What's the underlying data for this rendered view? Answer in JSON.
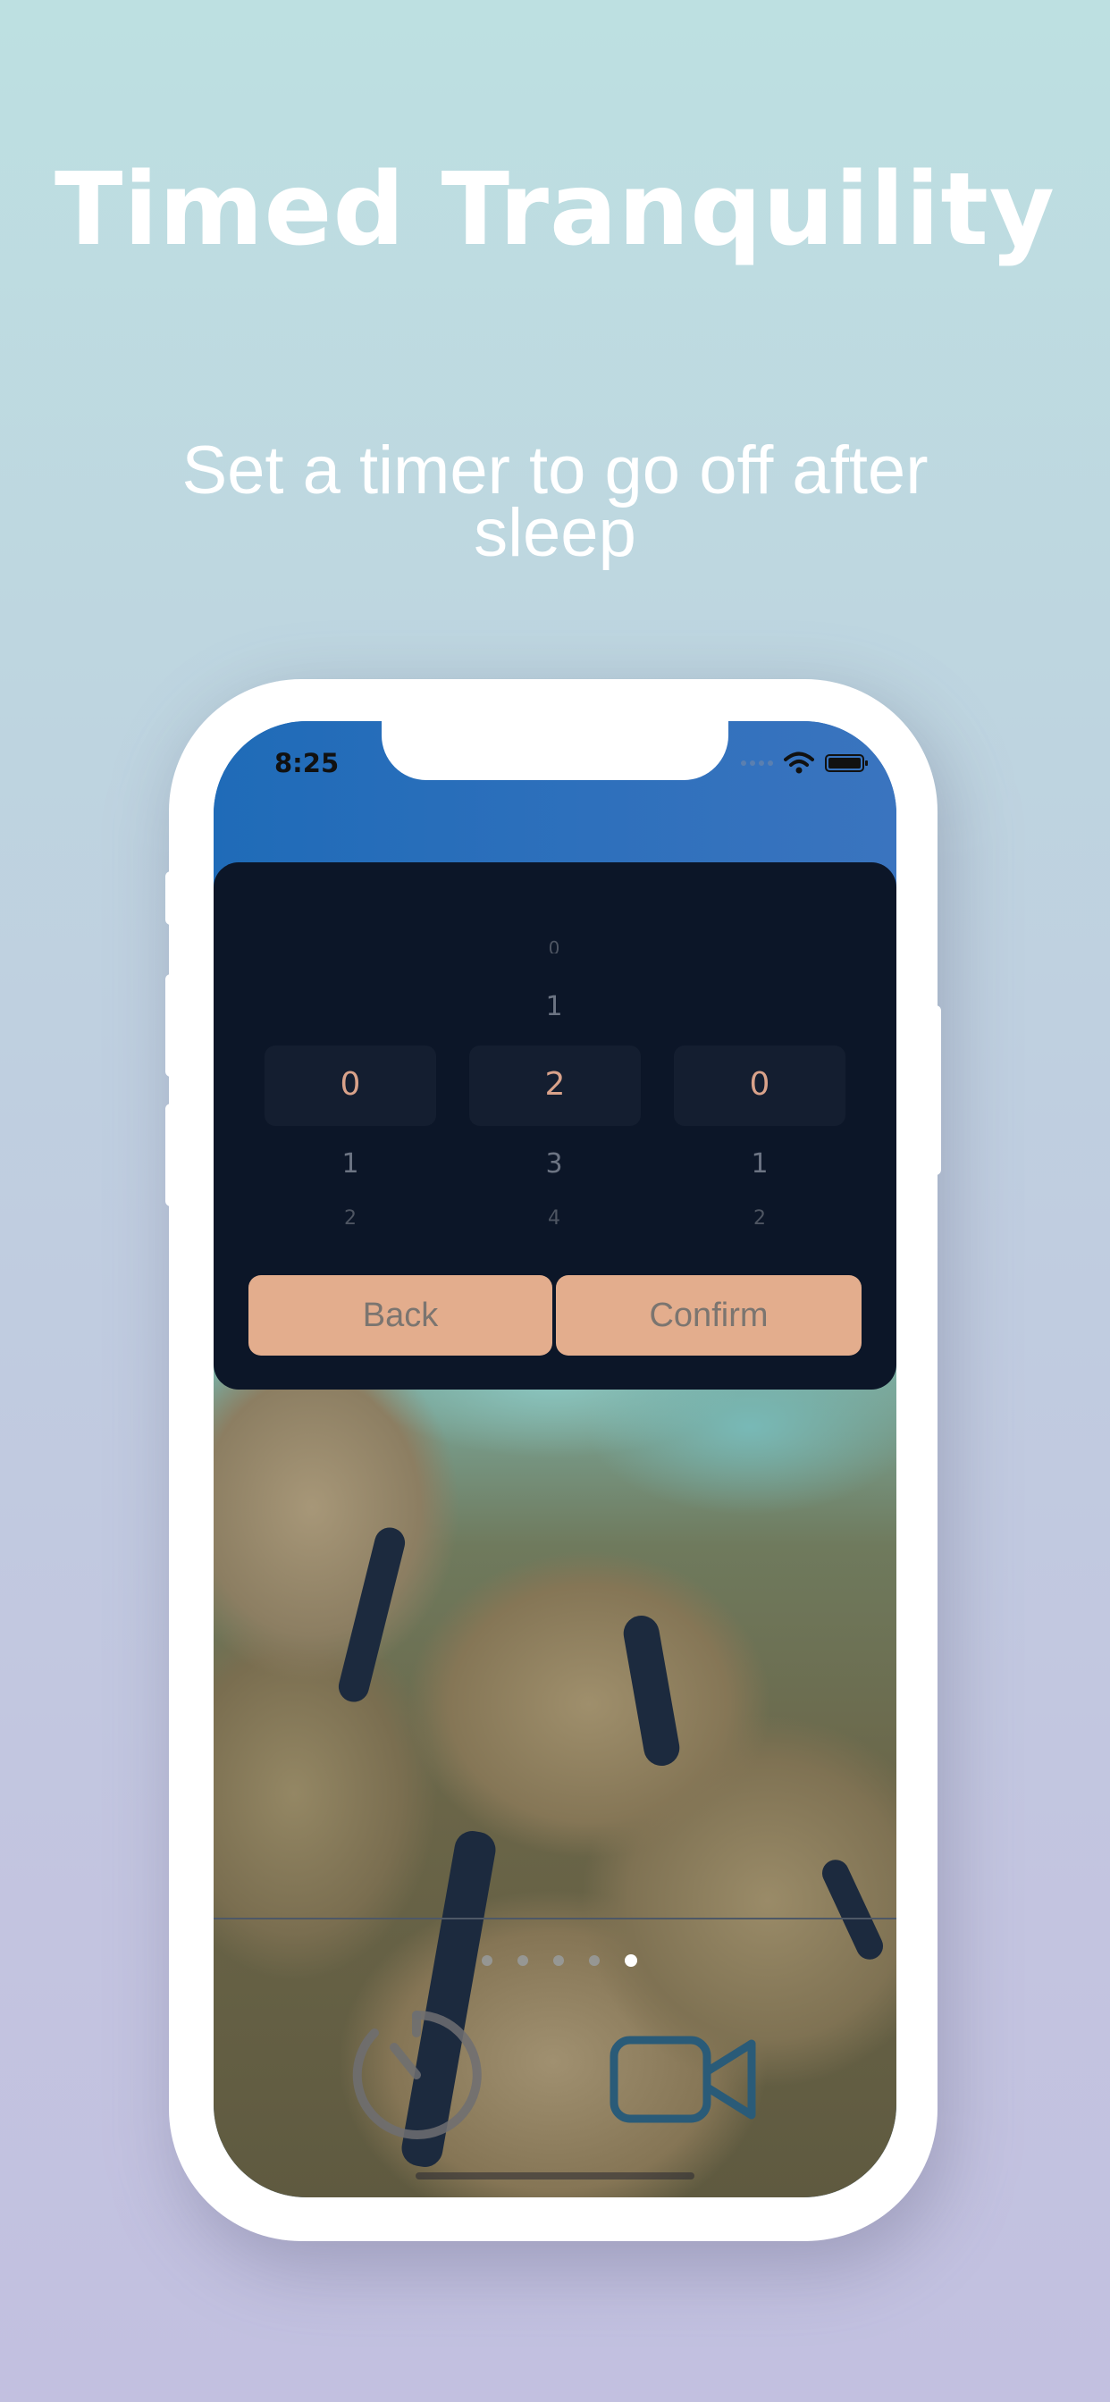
{
  "promo": {
    "headline": "Timed Tranquility",
    "subheadline": "Set a timer to go off after sleep"
  },
  "status_bar": {
    "time": "8:25",
    "icons": [
      "signal-dots-icon",
      "wifi-icon",
      "battery-icon"
    ]
  },
  "picker": {
    "columns": [
      {
        "above": [
          "",
          ""
        ],
        "selected": "0",
        "below": [
          "1",
          "2"
        ]
      },
      {
        "above": [
          "0",
          "1"
        ],
        "selected": "2",
        "below": [
          "3",
          "4"
        ]
      },
      {
        "above": [
          "",
          ""
        ],
        "selected": "0",
        "below": [
          "1",
          "2"
        ]
      }
    ],
    "back_label": "Back",
    "confirm_label": "Confirm"
  },
  "pager": {
    "count": 5,
    "active_index": 4
  },
  "toolbar": {
    "timer_icon": "timer-icon",
    "video_icon": "video-camera-icon"
  },
  "colors": {
    "picker_background": "#0c1628",
    "selected_digit": "#d9a28a",
    "button_background": "#e3ad8d",
    "video_icon": "#2a5b78"
  }
}
